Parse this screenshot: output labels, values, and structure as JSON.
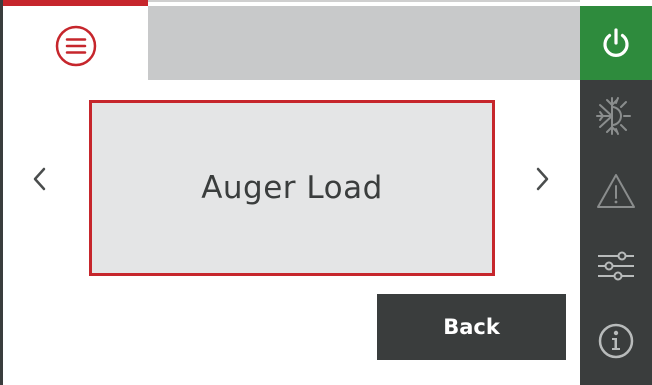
{
  "header": {
    "menu_icon": "menu-lines-icon"
  },
  "main": {
    "selection_label": "Auger Load",
    "prev_icon": "chevron-left-icon",
    "next_icon": "chevron-right-icon"
  },
  "footer": {
    "back_label": "Back"
  },
  "sidebar": {
    "items": [
      {
        "icon": "power-icon",
        "active": true
      },
      {
        "icon": "sun-snowflake-icon"
      },
      {
        "icon": "warning-triangle-icon"
      },
      {
        "icon": "sliders-icon"
      },
      {
        "icon": "info-icon"
      }
    ]
  },
  "colors": {
    "accent": "#c6262c",
    "power_active": "#2e8b3d",
    "sidebar": "#3a3d3d",
    "header_bar": "#c8c9ca",
    "selection_bg": "#e4e5e6"
  }
}
